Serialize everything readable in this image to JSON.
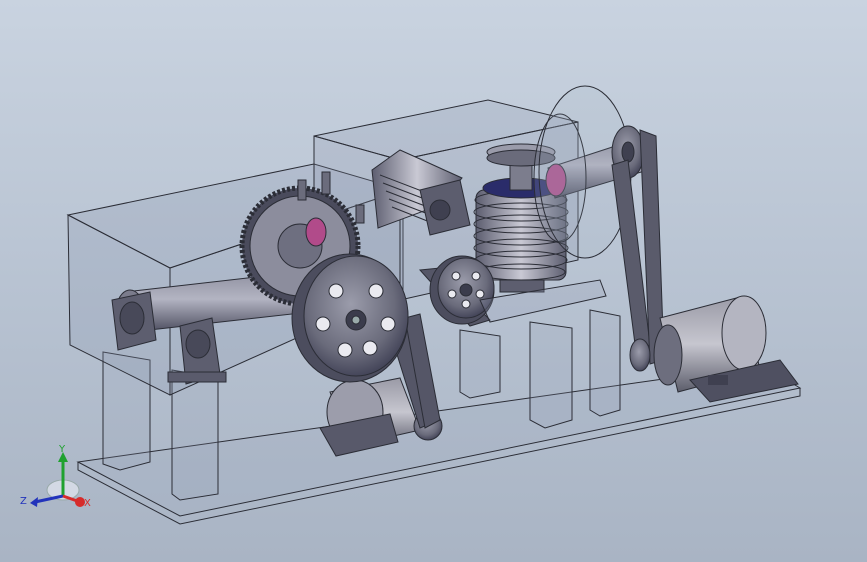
{
  "viewport": {
    "background_top": "#c9d3e0",
    "background_bottom": "#a9b4c4",
    "part_color": "#6c6d7e",
    "part_dark": "#3f4050",
    "part_light": "#a7a8b7",
    "transparent_edge": "#2b2d36",
    "highlight_color": "#b14b8a"
  },
  "triad": {
    "x_label": "X",
    "y_label": "Y",
    "z_label": "Z",
    "x_color": "#d62b2b",
    "y_color": "#1fa12f",
    "z_color": "#2233bb"
  }
}
